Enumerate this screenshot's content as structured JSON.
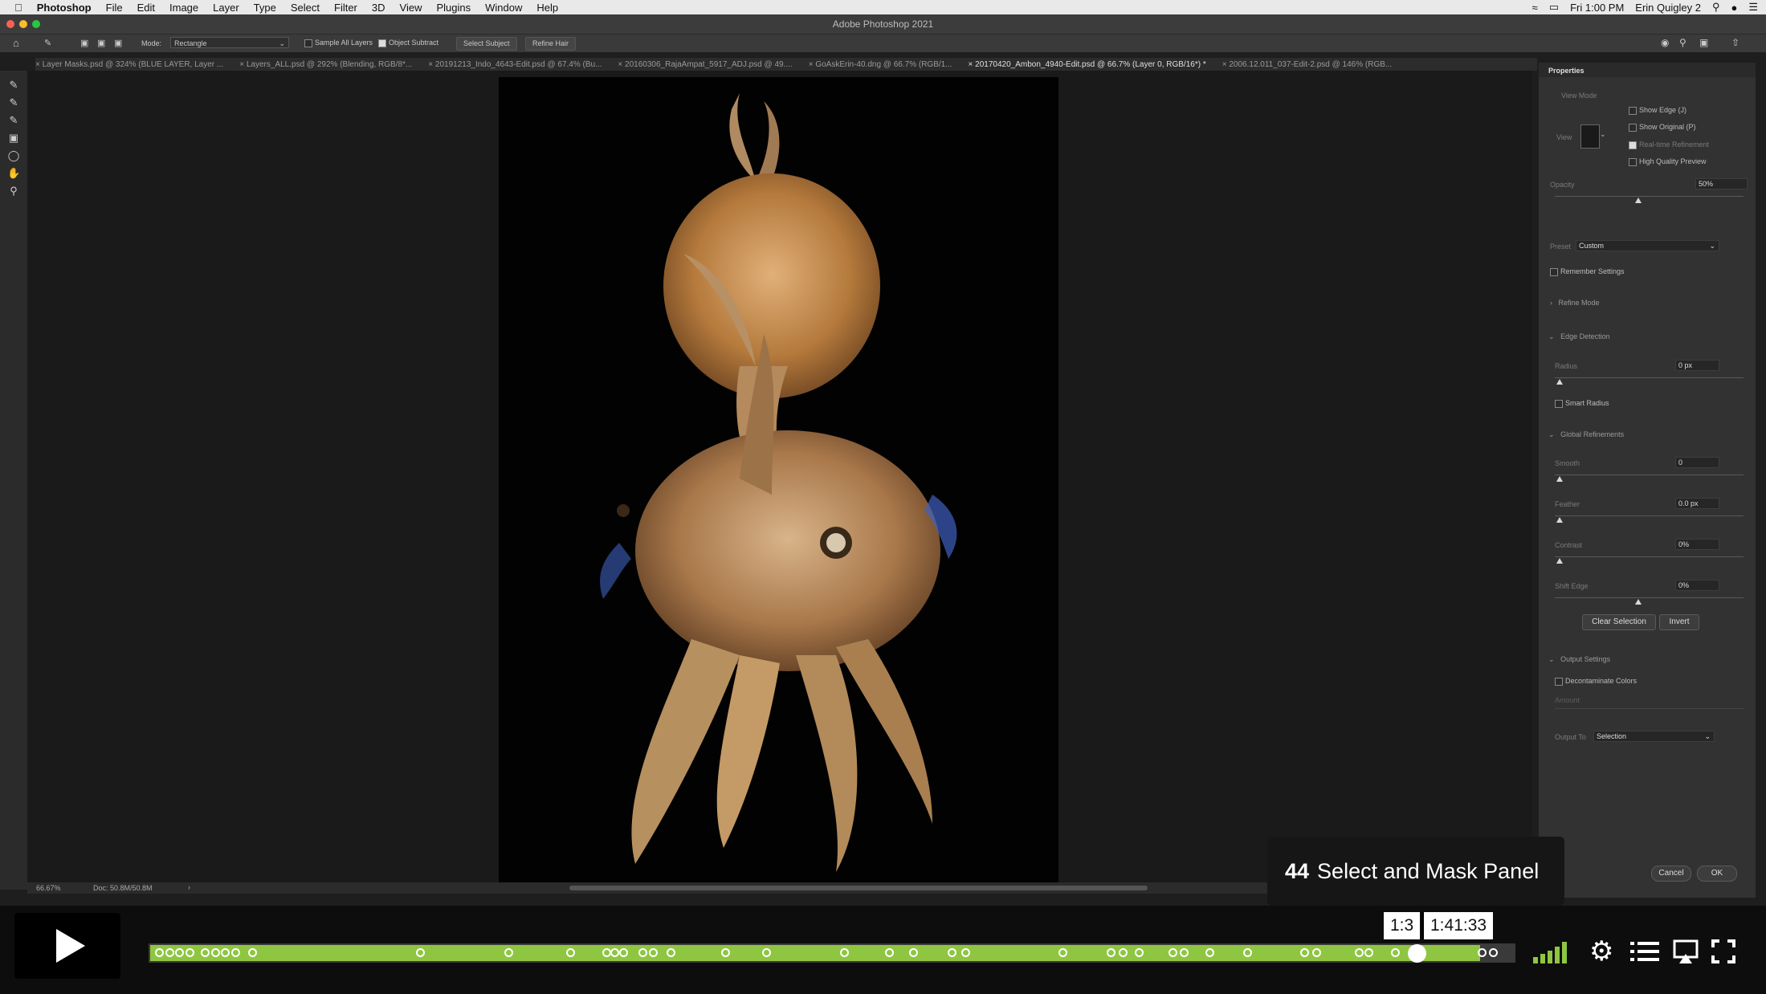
{
  "menubar": {
    "app": "Photoshop",
    "items": [
      "File",
      "Edit",
      "Image",
      "Layer",
      "Type",
      "Select",
      "Filter",
      "3D",
      "View",
      "Plugins",
      "Window",
      "Help"
    ],
    "clock": "Fri 1:00 PM",
    "user": "Erin Quigley 2"
  },
  "window": {
    "title": "Adobe Photoshop 2021"
  },
  "options": {
    "mode_label": "Mode:",
    "mode_value": "Rectangle",
    "sample_all_layers": "Sample All Layers",
    "object_subtract": "Object Subtract",
    "select_subject": "Select Subject",
    "refine_hair": "Refine Hair"
  },
  "tabs": [
    "Layer Masks.psd @ 324% (BLUE LAYER, Layer ...",
    "Layers_ALL.psd @ 292% (Blending, RGB/8*...",
    "20191213_Indo_4643-Edit.psd @ 67.4% (Bu...",
    "20160306_RajaAmpat_5917_ADJ.psd @ 49....",
    "GoAskErin-40.dng @ 66.7% (RGB/1...",
    "20170420_Ambon_4940-Edit.psd @ 66.7% (Layer 0, RGB/16*) *",
    "2006.12.011_037-Edit-2.psd @ 146% (RGB..."
  ],
  "status": {
    "zoom": "66.67%",
    "doc": "Doc: 50.8M/50.8M"
  },
  "properties": {
    "title": "Properties",
    "view_mode": "View Mode",
    "view": "View",
    "show_edge": "Show Edge (J)",
    "show_original": "Show Original (P)",
    "realtime_refinement": "Real-time Refinement",
    "high_quality_preview": "High Quality Preview",
    "opacity_label": "Opacity",
    "opacity_value": "50%",
    "preset_label": "Preset",
    "preset_value": "Custom",
    "remember_settings": "Remember Settings",
    "refine_mode": "Refine Mode",
    "edge_detection": "Edge Detection",
    "radius_label": "Radius",
    "radius_value": "0 px",
    "smart_radius": "Smart Radius",
    "global_refinements": "Global Refinements",
    "smooth_label": "Smooth",
    "smooth_value": "0",
    "feather_label": "Feather",
    "feather_value": "0.0 px",
    "contrast_label": "Contrast",
    "contrast_value": "0%",
    "shift_edge_label": "Shift Edge",
    "shift_edge_value": "0%",
    "clear_selection": "Clear Selection",
    "invert": "Invert",
    "output_settings": "Output Settings",
    "decontaminate": "Decontaminate Colors",
    "amount_label": "Amount",
    "output_to_label": "Output To",
    "output_to_value": "Selection",
    "cancel": "Cancel",
    "ok": "OK"
  },
  "video": {
    "chapter_number": "44",
    "chapter_title": "Select and Mask Panel",
    "time_partial": "1:3",
    "time_hover": "1:41:33",
    "progress_fraction": 0.975
  },
  "colors": {
    "progress": "#8ec641",
    "panel": "#323232",
    "background": "#1a1a1a"
  }
}
